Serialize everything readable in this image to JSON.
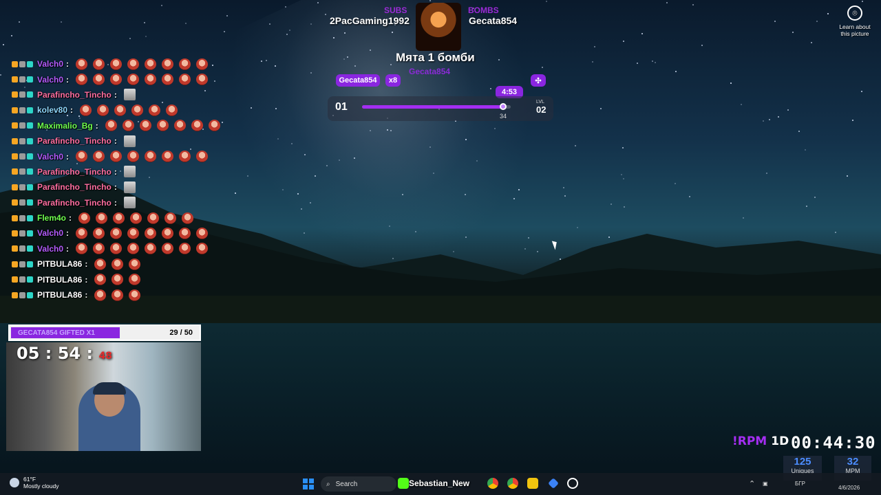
{
  "stream_header": {
    "subs_label": "SUBS",
    "bombs_label": "BOMBS",
    "left_user": "2PacGaming1992",
    "right_user": "Gecata854",
    "bomb_title": "Мята 1 бомби",
    "gift_name": "Gecata854"
  },
  "progress": {
    "gifter_pill": "Gecata854",
    "multiplier_pill": "x8",
    "time_pill": "4:53",
    "level_left": "01",
    "lvl_label": "LVL",
    "level_right": "02",
    "value_label": "34",
    "fill_fraction": 0.95
  },
  "chat": [
    {
      "user": "Valch0",
      "color": "#b45cff",
      "emotes": 8,
      "emote_type": "red"
    },
    {
      "user": "Valch0",
      "color": "#b45cff",
      "emotes": 8,
      "emote_type": "red"
    },
    {
      "user": "Parafincho_Tincho",
      "color": "#ff6fa1",
      "emotes": 1,
      "emote_type": "gray"
    },
    {
      "user": "kolev80",
      "color": "#8fd8ff",
      "emotes": 6,
      "emote_type": "red"
    },
    {
      "user": "Maximalio_Bg",
      "color": "#6fff4f",
      "emotes": 7,
      "emote_type": "red"
    },
    {
      "user": "Parafincho_Tincho",
      "color": "#ff6fa1",
      "emotes": 1,
      "emote_type": "gray"
    },
    {
      "user": "Valch0",
      "color": "#b45cff",
      "emotes": 8,
      "emote_type": "red"
    },
    {
      "user": "Parafincho_Tincho",
      "color": "#ff6fa1",
      "emotes": 1,
      "emote_type": "gray"
    },
    {
      "user": "Parafincho_Tincho",
      "color": "#ff6fa1",
      "emotes": 1,
      "emote_type": "gray"
    },
    {
      "user": "Parafincho_Tincho",
      "color": "#ff6fa1",
      "emotes": 1,
      "emote_type": "gray"
    },
    {
      "user": "Flem4o",
      "color": "#6fff4f",
      "emotes": 7,
      "emote_type": "red"
    },
    {
      "user": "Valch0",
      "color": "#b45cff",
      "emotes": 8,
      "emote_type": "red"
    },
    {
      "user": "Valch0",
      "color": "#b45cff",
      "emotes": 8,
      "emote_type": "red"
    },
    {
      "user": "PITBULA86",
      "color": "#ffffff",
      "emotes": 3,
      "emote_type": "red"
    },
    {
      "user": "PITBULA86",
      "color": "#ffffff",
      "emotes": 3,
      "emote_type": "red"
    },
    {
      "user": "PITBULA86",
      "color": "#ffffff",
      "emotes": 3,
      "emote_type": "red"
    }
  ],
  "gift_goal": {
    "label": "GECATA854 GIFTED X1",
    "count": "29 / 50",
    "fill_fraction": 0.58
  },
  "webcam_timer": {
    "hours": "05",
    "minutes": "54",
    "seconds": "48"
  },
  "overlay_bottom_right": {
    "command": "!RPM",
    "timeline": "1D",
    "clock": "00:44:30",
    "uniques_value": "125",
    "uniques_label": "Uniques",
    "mpm_value": "32",
    "mpm_label": "MPM"
  },
  "learn_picture": {
    "line1": "Learn about",
    "line2": "this picture"
  },
  "taskbar": {
    "temperature": "61°F",
    "weather": "Mostly cloudy",
    "search_placeholder": "Search",
    "overlay_name": "Sebastian_New",
    "language": "БГР",
    "date": "4/6/2026"
  },
  "colors": {
    "accent_purple": "#8a26e0",
    "stat_blue": "#4c8dff"
  }
}
